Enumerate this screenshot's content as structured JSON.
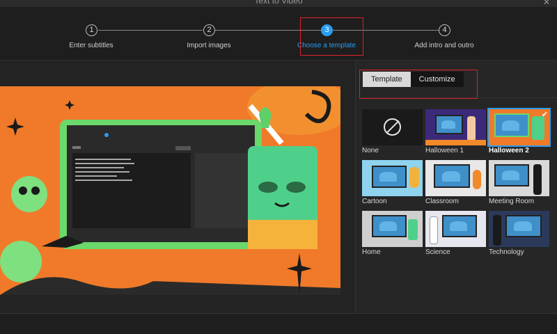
{
  "window": {
    "title": "Text to Video",
    "close_glyph": "✕"
  },
  "steps": [
    {
      "number": "1",
      "label": "Enter subtitles",
      "state": "done"
    },
    {
      "number": "2",
      "label": "Import images",
      "state": "done"
    },
    {
      "number": "3",
      "label": "Choose a template",
      "state": "active"
    },
    {
      "number": "4",
      "label": "Add intro and outro",
      "state": "pending"
    }
  ],
  "tabs": [
    {
      "label": "Template",
      "active": true
    },
    {
      "label": "Customize",
      "active": false
    }
  ],
  "templates": [
    {
      "name": "None",
      "selected": false
    },
    {
      "name": "Halloween 1",
      "selected": false
    },
    {
      "name": "Halloween 2",
      "selected": true
    },
    {
      "name": "Cartoon",
      "selected": false
    },
    {
      "name": "Classroom",
      "selected": false
    },
    {
      "name": "Meeting Room",
      "selected": false
    },
    {
      "name": "Home",
      "selected": false
    },
    {
      "name": "Science",
      "selected": false
    },
    {
      "name": "Technology",
      "selected": false
    }
  ],
  "colors": {
    "accent": "#2a9df4",
    "highlight_box": "#e0202a",
    "preview_bg": "#f07a2a"
  }
}
